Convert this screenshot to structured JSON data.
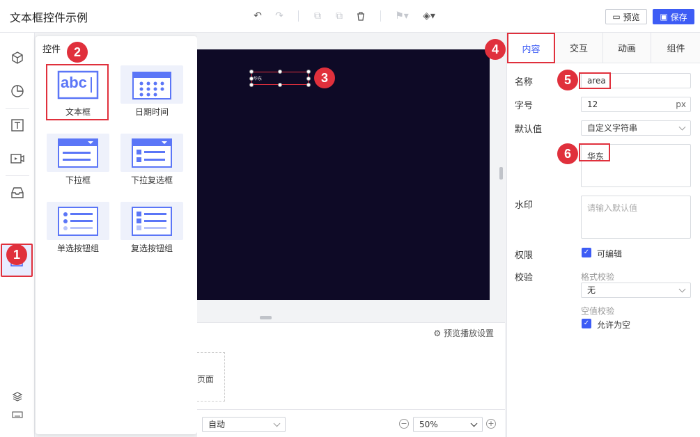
{
  "app": {
    "title": "文本框控件示例"
  },
  "toolbar": {
    "preview_label": "预览",
    "save_label": "保存"
  },
  "panel": {
    "title": "控件",
    "items": [
      {
        "label": "文本框",
        "card_text": "abc"
      },
      {
        "label": "日期时间"
      },
      {
        "label": "下拉框"
      },
      {
        "label": "下拉复选框"
      },
      {
        "label": "单选按钮组"
      },
      {
        "label": "复选按钮组"
      }
    ]
  },
  "canvas": {
    "widget_text": "华东"
  },
  "bottom": {
    "preview_setting": "预览播放设置",
    "page_text": "页面",
    "auto_select": "自动",
    "zoom": "50%"
  },
  "badges": [
    "1",
    "2",
    "3",
    "4",
    "5",
    "6"
  ],
  "right": {
    "tabs": [
      "内容",
      "交互",
      "动画",
      "组件"
    ],
    "name_label": "名称",
    "name_value": "area",
    "fontsize_label": "字号",
    "fontsize_value": "12",
    "fontsize_unit": "px",
    "default_label": "默认值",
    "default_type": "自定义字符串",
    "default_text": "华东",
    "watermark_label": "水印",
    "watermark_placeholder": "请输入默认值",
    "perm_label": "权限",
    "perm_option": "可编辑",
    "validate_label": "校验",
    "format_label": "格式校验",
    "format_value": "无",
    "empty_label": "空值校验",
    "empty_option": "允许为空"
  },
  "colors": {
    "accent": "#3d5cf5",
    "highlight": "#e0303c",
    "stage": "#0e0a26"
  }
}
